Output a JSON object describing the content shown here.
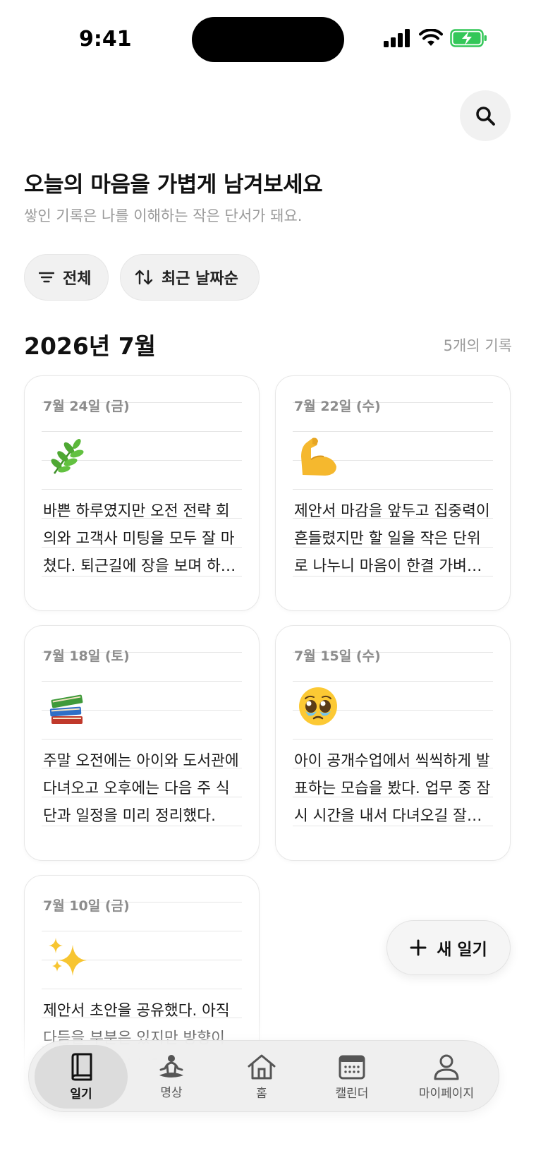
{
  "status_bar": {
    "time": "9:41"
  },
  "header": {
    "search_icon": "search-icon",
    "headline": "오늘의 마음을 가볍게 남겨보세요",
    "subline": "쌓인 기록은 나를 이해하는 작은 단서가 돼요."
  },
  "filters": {
    "filter_label": "전체",
    "filter_icon": "filter-lines-icon",
    "sort_label": "최근 날짜순",
    "sort_icon": "sort-arrows-icon"
  },
  "section": {
    "month": "2026년 7월",
    "count": "5개의 기록"
  },
  "entries": [
    {
      "date": "7월 24일 (금)",
      "emoji": "herb",
      "text": "바쁜 하루였지만 오전 전략 회의와 고객사 미팅을 모두 잘 마쳤다. 퇴근길에 장을 보며 하루를 정리했다."
    },
    {
      "date": "7월 22일 (수)",
      "emoji": "flexed-biceps",
      "text": "제안서 마감을 앞두고 집중력이 흔들렸지만 할 일을 작은 단위로 나누니 마음이 한결 가벼워졌다."
    },
    {
      "date": "7월 18일 (토)",
      "emoji": "books",
      "text": "주말 오전에는 아이와 도서관에 다녀오고 오후에는 다음 주 식단과 일정을 미리 정리했다."
    },
    {
      "date": "7월 15일 (수)",
      "emoji": "pleading-face",
      "text": "아이 공개수업에서 씩씩하게 발표하는 모습을 봤다. 업무 중 잠시 시간을 내서 다녀오길 잘했다."
    },
    {
      "date": "7월 10일 (금)",
      "emoji": "sparkles",
      "text": "제안서 초안을 공유했다. 아직 다듬을 부분은 있지만 방향이 잡혀서 마음이 놓였다."
    }
  ],
  "fab": {
    "label": "새 일기",
    "icon": "plus-icon"
  },
  "tab_bar": {
    "items": [
      {
        "label": "일기",
        "icon": "diary-book-icon",
        "active": true
      },
      {
        "label": "명상",
        "icon": "meditation-icon",
        "active": false
      },
      {
        "label": "홈",
        "icon": "home-icon",
        "active": false
      },
      {
        "label": "캘린더",
        "icon": "calendar-icon",
        "active": false
      },
      {
        "label": "마이페이지",
        "icon": "profile-icon",
        "active": false
      }
    ]
  },
  "colors": {
    "background": "#ffffff",
    "chip_bg": "#f1f1f1",
    "muted_text": "#9a9a9a",
    "battery_green": "#34c759"
  }
}
